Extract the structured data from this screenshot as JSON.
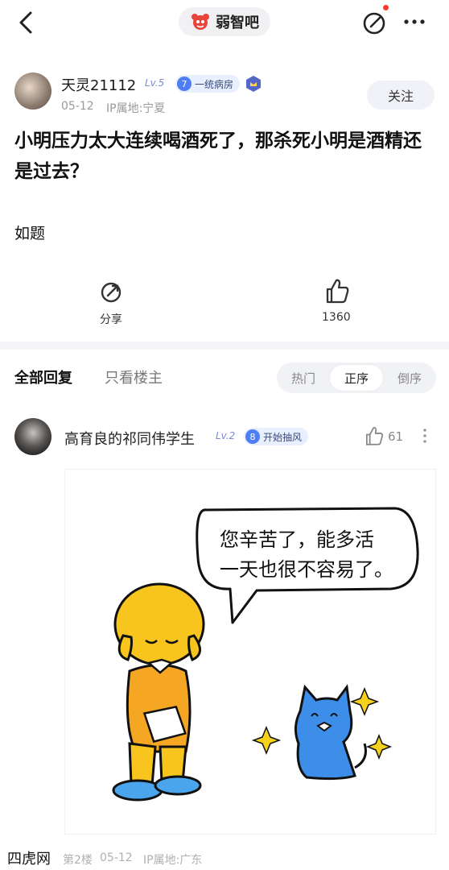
{
  "header": {
    "forum_name": "弱智吧"
  },
  "post": {
    "author": "天灵21112",
    "level": "Lv.5",
    "member_level": "7",
    "member_title": "一统病房",
    "date": "05-12",
    "ip": "IP属地:宁夏",
    "follow_label": "关注",
    "title": "小明压力太大连续喝酒死了，那杀死小明是酒精还是过去？",
    "body": "如题",
    "share_label": "分享",
    "like_count": "1360"
  },
  "replies_header": {
    "all_label": "全部回复",
    "op_only_label": "只看楼主",
    "sort_options": [
      "热门",
      "正序",
      "倒序"
    ],
    "active_sort": "正序"
  },
  "reply": {
    "author": "高育良的祁同伟学生",
    "level": "Lv.2",
    "member_level": "8",
    "member_title": "开始抽风",
    "like_count": "61",
    "comic_text_line1": "您辛苦了，能多活",
    "comic_text_line2": "一天也很不容易了。",
    "floor": "第2楼",
    "date": "05-12",
    "ip": "IP属地:广东"
  },
  "watermark": "四虎网",
  "colors": {
    "accent_blue": "#4e7ef5",
    "comic_yellow": "#f7c51d",
    "comic_blue": "#3d8ee8"
  }
}
